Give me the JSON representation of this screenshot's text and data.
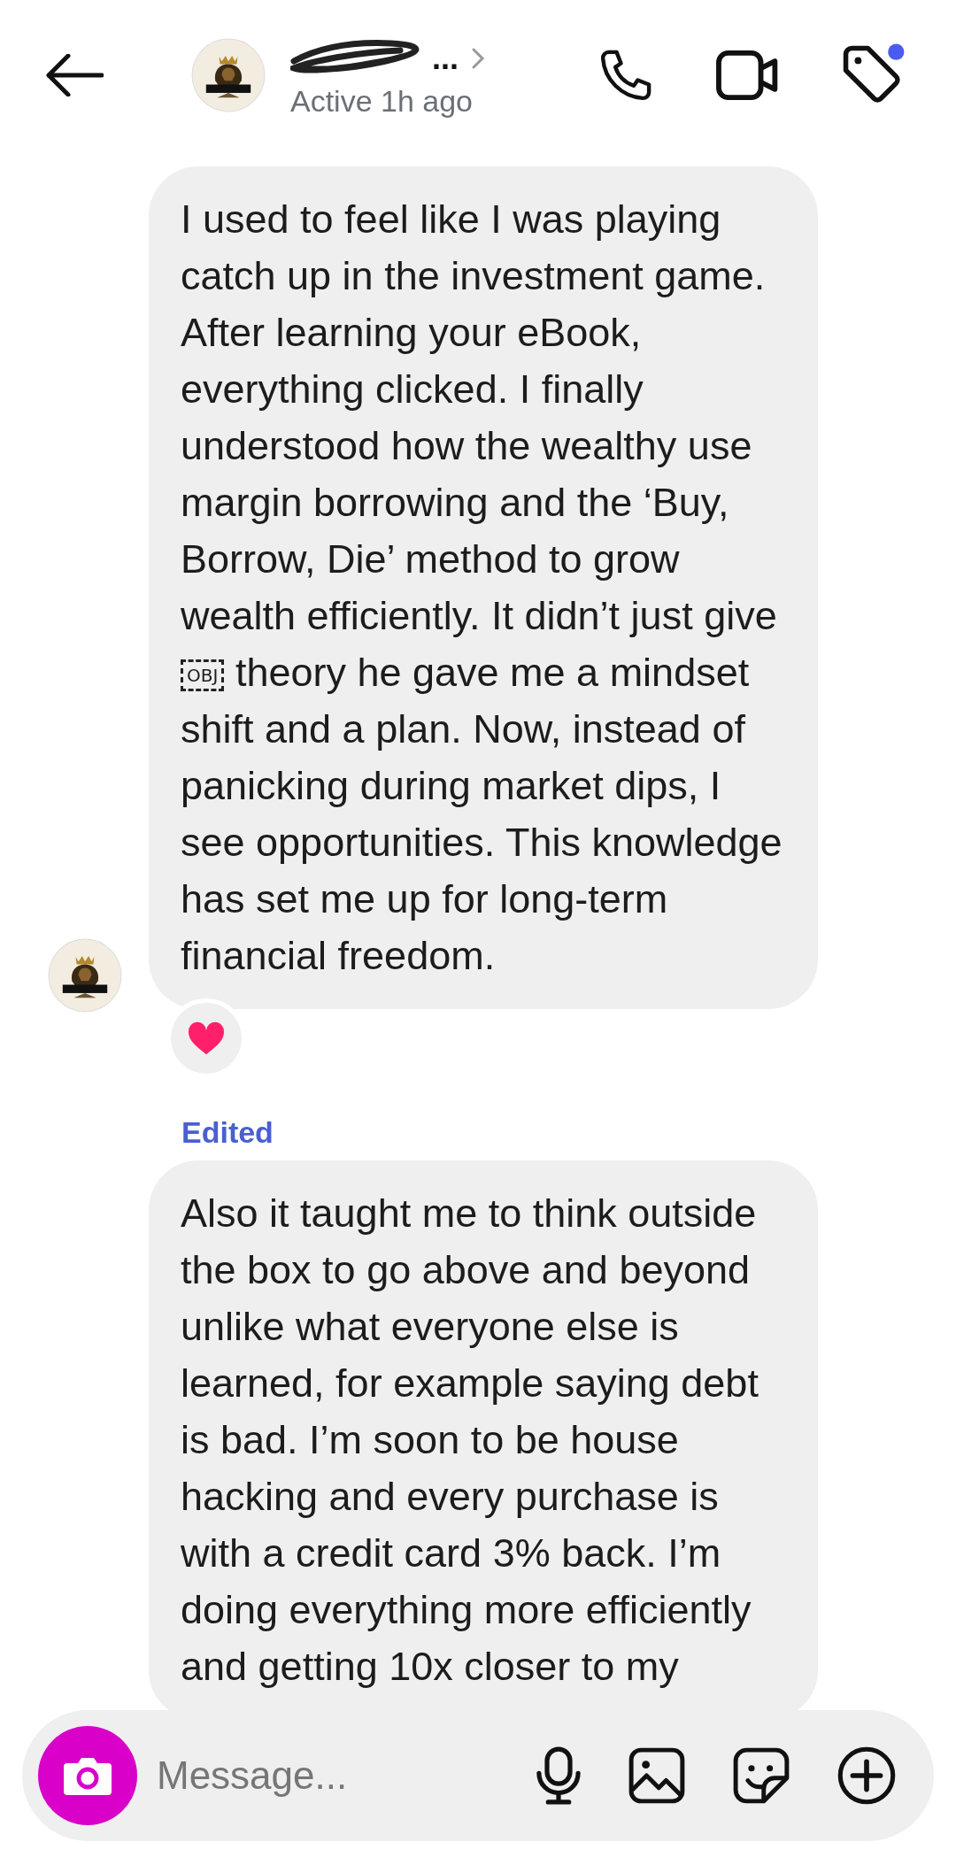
{
  "header": {
    "name": "...",
    "status": "Active 1h ago",
    "tag_unread": true
  },
  "messages": [
    {
      "parts": [
        {
          "kind": "text",
          "text": "I used to feel like I was playing catch up in the investment game. After learning your eBook, everything clicked. I finally understood how the wealthy use margin borrowing and the ‘Buy, Borrow, Die’ method to grow wealth efficiently. It didn’t just give "
        },
        {
          "kind": "object",
          "label": "OBJ"
        },
        {
          "kind": "text",
          "text": " theory he gave me a mindset shift and a plan. Now, instead of panicking during market dips, I see opportunities. This knowledge has set me up for long-term financial freedom."
        }
      ],
      "show_avatar": true,
      "hearted": true
    },
    {
      "label": "Edited",
      "parts": [
        {
          "kind": "text",
          "text": "Also it taught me to think outside the box to go above and beyond unlike what everyone else is learned, for example saying debt is bad. I’m soon to be house hacking and every purchase is with a credit card 3% back. I’m doing everything more efficiently and getting 10x closer to my"
        }
      ],
      "show_avatar": false,
      "hearted": false
    }
  ],
  "composer": {
    "placeholder": "Message..."
  }
}
